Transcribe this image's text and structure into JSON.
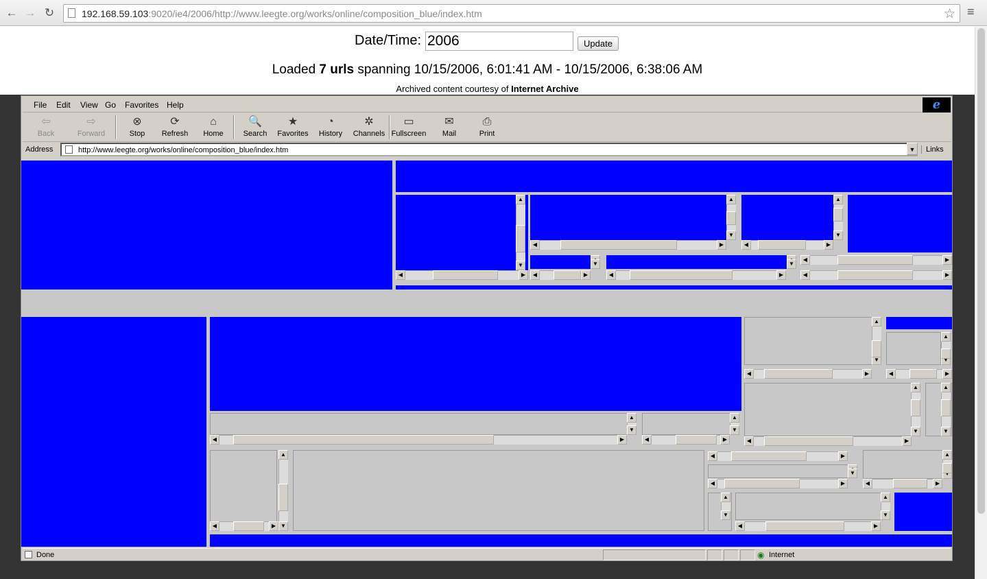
{
  "browser": {
    "url_host": "192.168.59.103",
    "url_rest": ":9020/ie4/2006/http://www.leegte.org/works/online/composition_blue/index.htm"
  },
  "wayback": {
    "datetime_label": "Date/Time:",
    "datetime_value": "2006",
    "update_label": "Update",
    "loaded_prefix": "Loaded ",
    "loaded_count": "7 urls",
    "loaded_suffix": " spanning 10/15/2006, 6:01:41 AM - 10/15/2006, 6:38:06 AM",
    "courtesy_prefix": "Archived content courtesy of ",
    "courtesy_name": "Internet Archive"
  },
  "ie": {
    "menu": [
      "File",
      "Edit",
      "View",
      "Go",
      "Favorites",
      "Help"
    ],
    "toolbar": [
      {
        "label": "Back",
        "icon": "back-arrow-icon",
        "glyph": "⇦",
        "disabled": true
      },
      {
        "label": "Forward",
        "icon": "forward-arrow-icon",
        "glyph": "⇨",
        "disabled": true
      },
      {
        "label": "Stop",
        "icon": "stop-icon",
        "glyph": "⊗"
      },
      {
        "label": "Refresh",
        "icon": "refresh-icon",
        "glyph": "⟳"
      },
      {
        "label": "Home",
        "icon": "home-icon",
        "glyph": "⌂"
      },
      {
        "label": "Search",
        "icon": "search-icon",
        "glyph": "🔍"
      },
      {
        "label": "Favorites",
        "icon": "favorites-icon",
        "glyph": "★"
      },
      {
        "label": "History",
        "icon": "history-icon",
        "glyph": "◔"
      },
      {
        "label": "Channels",
        "icon": "channels-icon",
        "glyph": "✲"
      },
      {
        "label": "Fullscreen",
        "icon": "fullscreen-icon",
        "glyph": "▭"
      },
      {
        "label": "Mail",
        "icon": "mail-icon",
        "glyph": "✉"
      },
      {
        "label": "Print",
        "icon": "print-icon",
        "glyph": "⎙"
      }
    ],
    "address_label": "Address",
    "address_value": "http://www.leegte.org/works/online/composition_blue/index.htm",
    "links_label": "Links",
    "status_text": "Done",
    "zone_text": "Internet"
  },
  "colors": {
    "frame_blue": "#0000ff",
    "frame_gray": "#c8c8c8"
  }
}
